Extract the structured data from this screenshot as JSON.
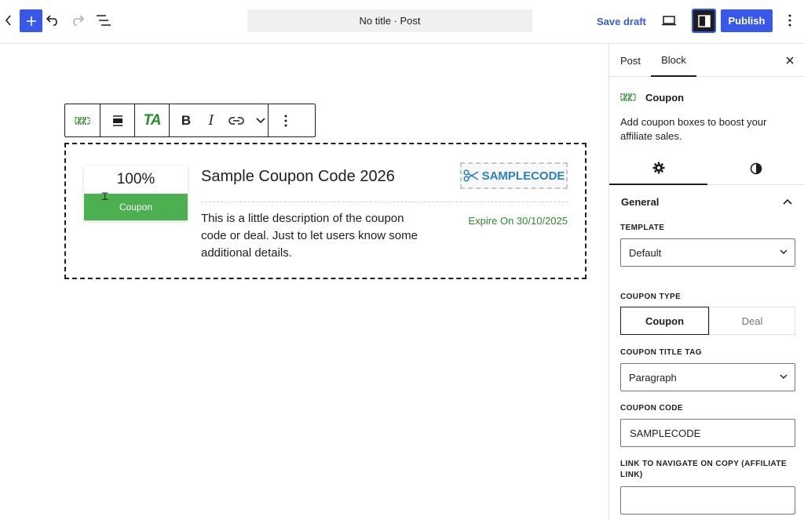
{
  "topbar": {
    "document_title": "No title · Post",
    "save_draft_label": "Save draft",
    "publish_label": "Publish",
    "accent_color": "#3858e9"
  },
  "block_toolbar": {
    "items": [
      "coupon-logo-icon",
      "align-icon",
      "TA",
      "B",
      "I",
      "link-icon",
      "chevron-down-icon",
      "more-vertical-icon"
    ],
    "ta_label": "TA",
    "bold_label": "B",
    "italic_label": "I"
  },
  "coupon": {
    "discount": "100%",
    "button_label": "Coupon",
    "title": "Sample Coupon Code 2026",
    "code": "SAMPLECODE",
    "description": "This is a little description of the coupon code or deal. Just to let users know some additional details.",
    "expire": "Expire On 30/10/2025",
    "button_color": "#4caf50",
    "expire_color": "#2e8b2e",
    "code_color": "#2d7fbf"
  },
  "sidebar": {
    "tabs": [
      "Post",
      "Block"
    ],
    "active_tab": "Block",
    "block": {
      "name": "Coupon",
      "description": "Add coupon boxes to boost your affiliate sales."
    },
    "panel": {
      "title": "General",
      "template_label": "Template",
      "template_value": "Default",
      "coupon_type_label": "Coupon Type",
      "coupon_type_options": [
        "Coupon",
        "Deal"
      ],
      "coupon_type_selected": "Coupon",
      "title_tag_label": "Coupon Title Tag",
      "title_tag_value": "Paragraph",
      "coupon_code_label": "Coupon Code",
      "coupon_code_value": "SAMPLECODE",
      "link_label": "Link to navigate on copy (Affiliate Link)",
      "link_value": ""
    }
  }
}
